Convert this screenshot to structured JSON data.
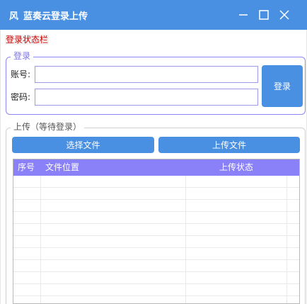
{
  "window": {
    "app_icon_glyph": "风",
    "title": "蓝奏云登录上传"
  },
  "status": {
    "text": "登录状态栏"
  },
  "login": {
    "group_title": "登录",
    "account_label": "账号:",
    "password_label": "密码:",
    "account_value": "",
    "password_value": "",
    "login_button": "登录"
  },
  "upload": {
    "group_title": "上传（等待登录）",
    "select_button": "选择文件",
    "upload_button": "上传文件",
    "table": {
      "columns": [
        "序号",
        "文件位置",
        "上传状态"
      ],
      "rows": []
    }
  },
  "colors": {
    "accent": "#4a90e2",
    "header_purple": "#8a80f8",
    "status_red": "#d60000"
  }
}
